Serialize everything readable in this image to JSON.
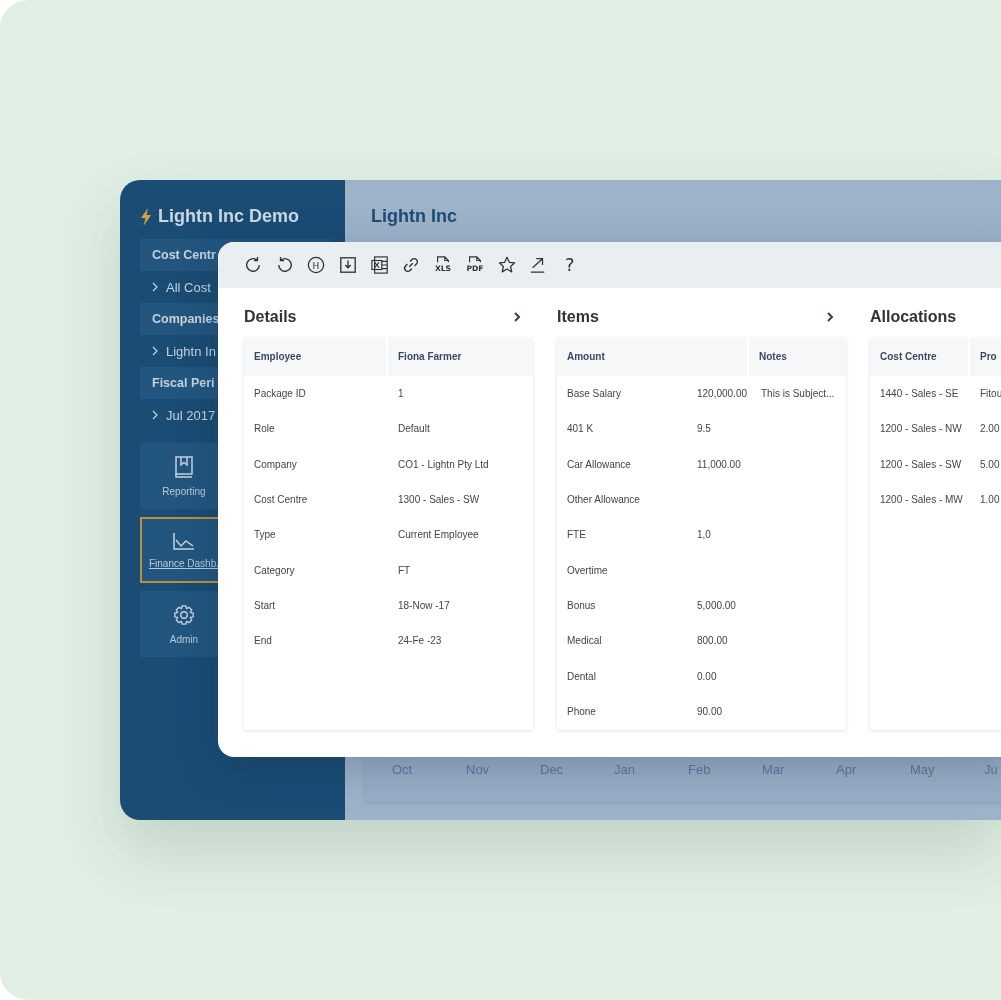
{
  "sidebar": {
    "title": "Lightn Inc Demo",
    "sections": [
      {
        "heading": "Cost Centr",
        "item": "All Cost"
      },
      {
        "heading": "Companies",
        "item": "Lightn In"
      },
      {
        "heading": "Fiscal Peri",
        "item": "Jul 2017"
      }
    ],
    "tiles": [
      {
        "kind": "book",
        "label": "Reporting",
        "selected": false
      },
      {
        "kind": "chart",
        "label": "Finance Dashb.",
        "selected": true
      },
      {
        "kind": "gear",
        "label": "Admin",
        "selected": false
      }
    ]
  },
  "main": {
    "title": "Lightn Inc",
    "months": [
      "Oct",
      "Nov",
      "Dec",
      "Jan",
      "Feb",
      "Mar",
      "Apr",
      "May",
      "Ju"
    ]
  },
  "dialog": {
    "toolbar": [
      {
        "kind": "refresh"
      },
      {
        "kind": "undo"
      },
      {
        "kind": "history",
        "label": "H"
      },
      {
        "kind": "download"
      },
      {
        "kind": "excel"
      },
      {
        "kind": "link"
      },
      {
        "kind": "file",
        "label": "XLS"
      },
      {
        "kind": "file",
        "label": "PDF"
      },
      {
        "kind": "star"
      },
      {
        "kind": "export"
      },
      {
        "kind": "help",
        "label": "?"
      }
    ],
    "panels": [
      {
        "kind": "pairs",
        "title": "Details",
        "more_button": true,
        "columns": [
          "Employee",
          "Fiona Farmer"
        ],
        "rows": [
          {
            "name": "Package ID",
            "value": "1"
          },
          {
            "name": "Role",
            "value": "Default"
          },
          {
            "name": "Company",
            "value": "CO1 - Lightn Pty Ltd"
          },
          {
            "name": "Cost Centre",
            "value": "1300 - Sales - SW"
          },
          {
            "name": "Type",
            "value": "Current Employee"
          },
          {
            "name": "Category",
            "value": "FT"
          },
          {
            "name": "Start",
            "value": "18-Now -17"
          },
          {
            "name": "End",
            "value": "24-Fe -23"
          }
        ]
      },
      {
        "kind": "items",
        "title": "Items",
        "more_button": true,
        "columns": [
          "Amount",
          "Notes"
        ],
        "rows": [
          {
            "name": "Base Salary",
            "amount": "120,000.00",
            "notes": "This is Subject..."
          },
          {
            "name": "401 K",
            "amount": "9.5"
          },
          {
            "name": "Car Allowance",
            "amount": "11,000.00"
          },
          {
            "name": "Other Allowance"
          },
          {
            "name": "FTE",
            "amount": "1,0"
          },
          {
            "name": "Overtime"
          },
          {
            "name": "Bonus",
            "amount": "5,000.00"
          },
          {
            "name": "Medical",
            "amount": "800.00"
          },
          {
            "name": "Dental",
            "amount": "0.00"
          },
          {
            "name": "Phone",
            "amount": "90.00"
          }
        ]
      },
      {
        "kind": "pairs",
        "title": "Allocations",
        "more_button": false,
        "columns": [
          "Cost Centre",
          "Pro"
        ],
        "rows": [
          {
            "name": "1440 - Sales - SE",
            "value": "Fitou"
          },
          {
            "name": "1200 - Sales - NW",
            "value": "2.00"
          },
          {
            "name": "1200 - Sales - SW",
            "value": "5.00"
          },
          {
            "name": "1200 - Sales - MW",
            "value": "1.00"
          }
        ]
      }
    ]
  }
}
